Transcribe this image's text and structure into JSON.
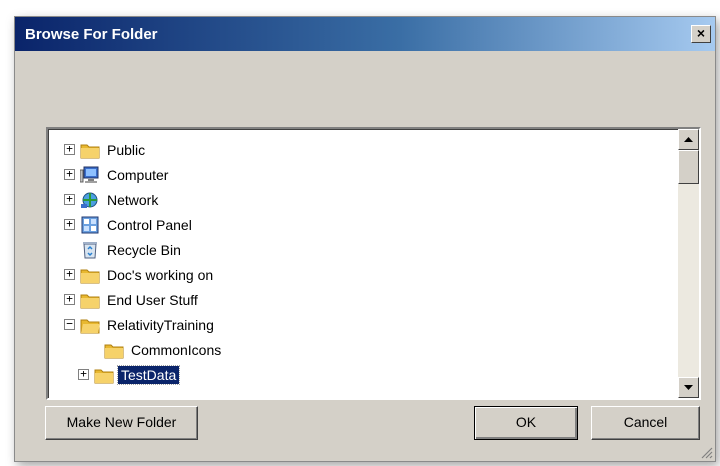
{
  "dialog": {
    "title": "Browse For Folder",
    "close_glyph": "×"
  },
  "tree": {
    "items": [
      {
        "label": "Public",
        "icon": "folder-icon",
        "expander": "+",
        "selected": false
      },
      {
        "label": "Computer",
        "icon": "computer-icon",
        "expander": "+",
        "selected": false
      },
      {
        "label": "Network",
        "icon": "network-icon",
        "expander": "+",
        "selected": false
      },
      {
        "label": "Control Panel",
        "icon": "control-panel-icon",
        "expander": "+",
        "selected": false
      },
      {
        "label": "Recycle Bin",
        "icon": "recycle-bin-icon",
        "expander": "",
        "selected": false
      },
      {
        "label": "Doc's working on",
        "icon": "folder-icon",
        "expander": "+",
        "selected": false
      },
      {
        "label": "End User Stuff",
        "icon": "folder-icon",
        "expander": "+",
        "selected": false
      },
      {
        "label": "RelativityTraining",
        "icon": "folder-icon",
        "expander": "−",
        "selected": false
      },
      {
        "label": "CommonIcons",
        "icon": "folder-icon",
        "expander": "",
        "selected": false
      },
      {
        "label": "TestData",
        "icon": "folder-icon",
        "expander": "+",
        "selected": true
      }
    ]
  },
  "buttons": {
    "make_new_folder": "Make New Folder",
    "ok": "OK",
    "cancel": "Cancel"
  },
  "colors": {
    "selection": "#0a246a",
    "folder": "#e8b830"
  }
}
